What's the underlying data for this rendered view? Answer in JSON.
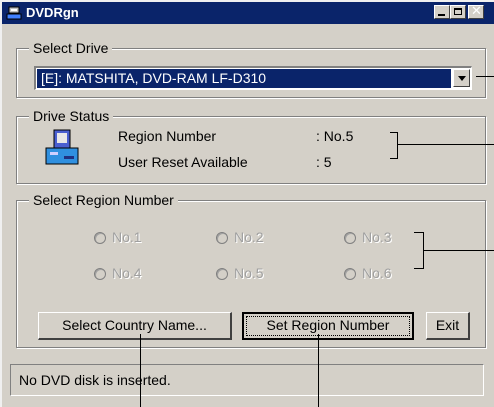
{
  "window": {
    "title": "DVDRgn",
    "app_icon": "disc-drive-icon"
  },
  "select_drive": {
    "legend": "Select Drive",
    "selected": "[E]: MATSHITA, DVD-RAM LF-D310"
  },
  "drive_status": {
    "legend": "Drive Status",
    "icon": "drive-icon",
    "region_label": "Region Number",
    "region_value": ": No.5",
    "reset_label": "User Reset Available",
    "reset_value": ": 5"
  },
  "select_region": {
    "legend": "Select Region Number",
    "options": [
      "No.1",
      "No.2",
      "No.3",
      "No.4",
      "No.5",
      "No.6"
    ]
  },
  "buttons": {
    "country": "Select Country Name...",
    "set_region": "Set Region Number",
    "exit": "Exit"
  },
  "status_bar": {
    "text": "No DVD disk is inserted."
  }
}
